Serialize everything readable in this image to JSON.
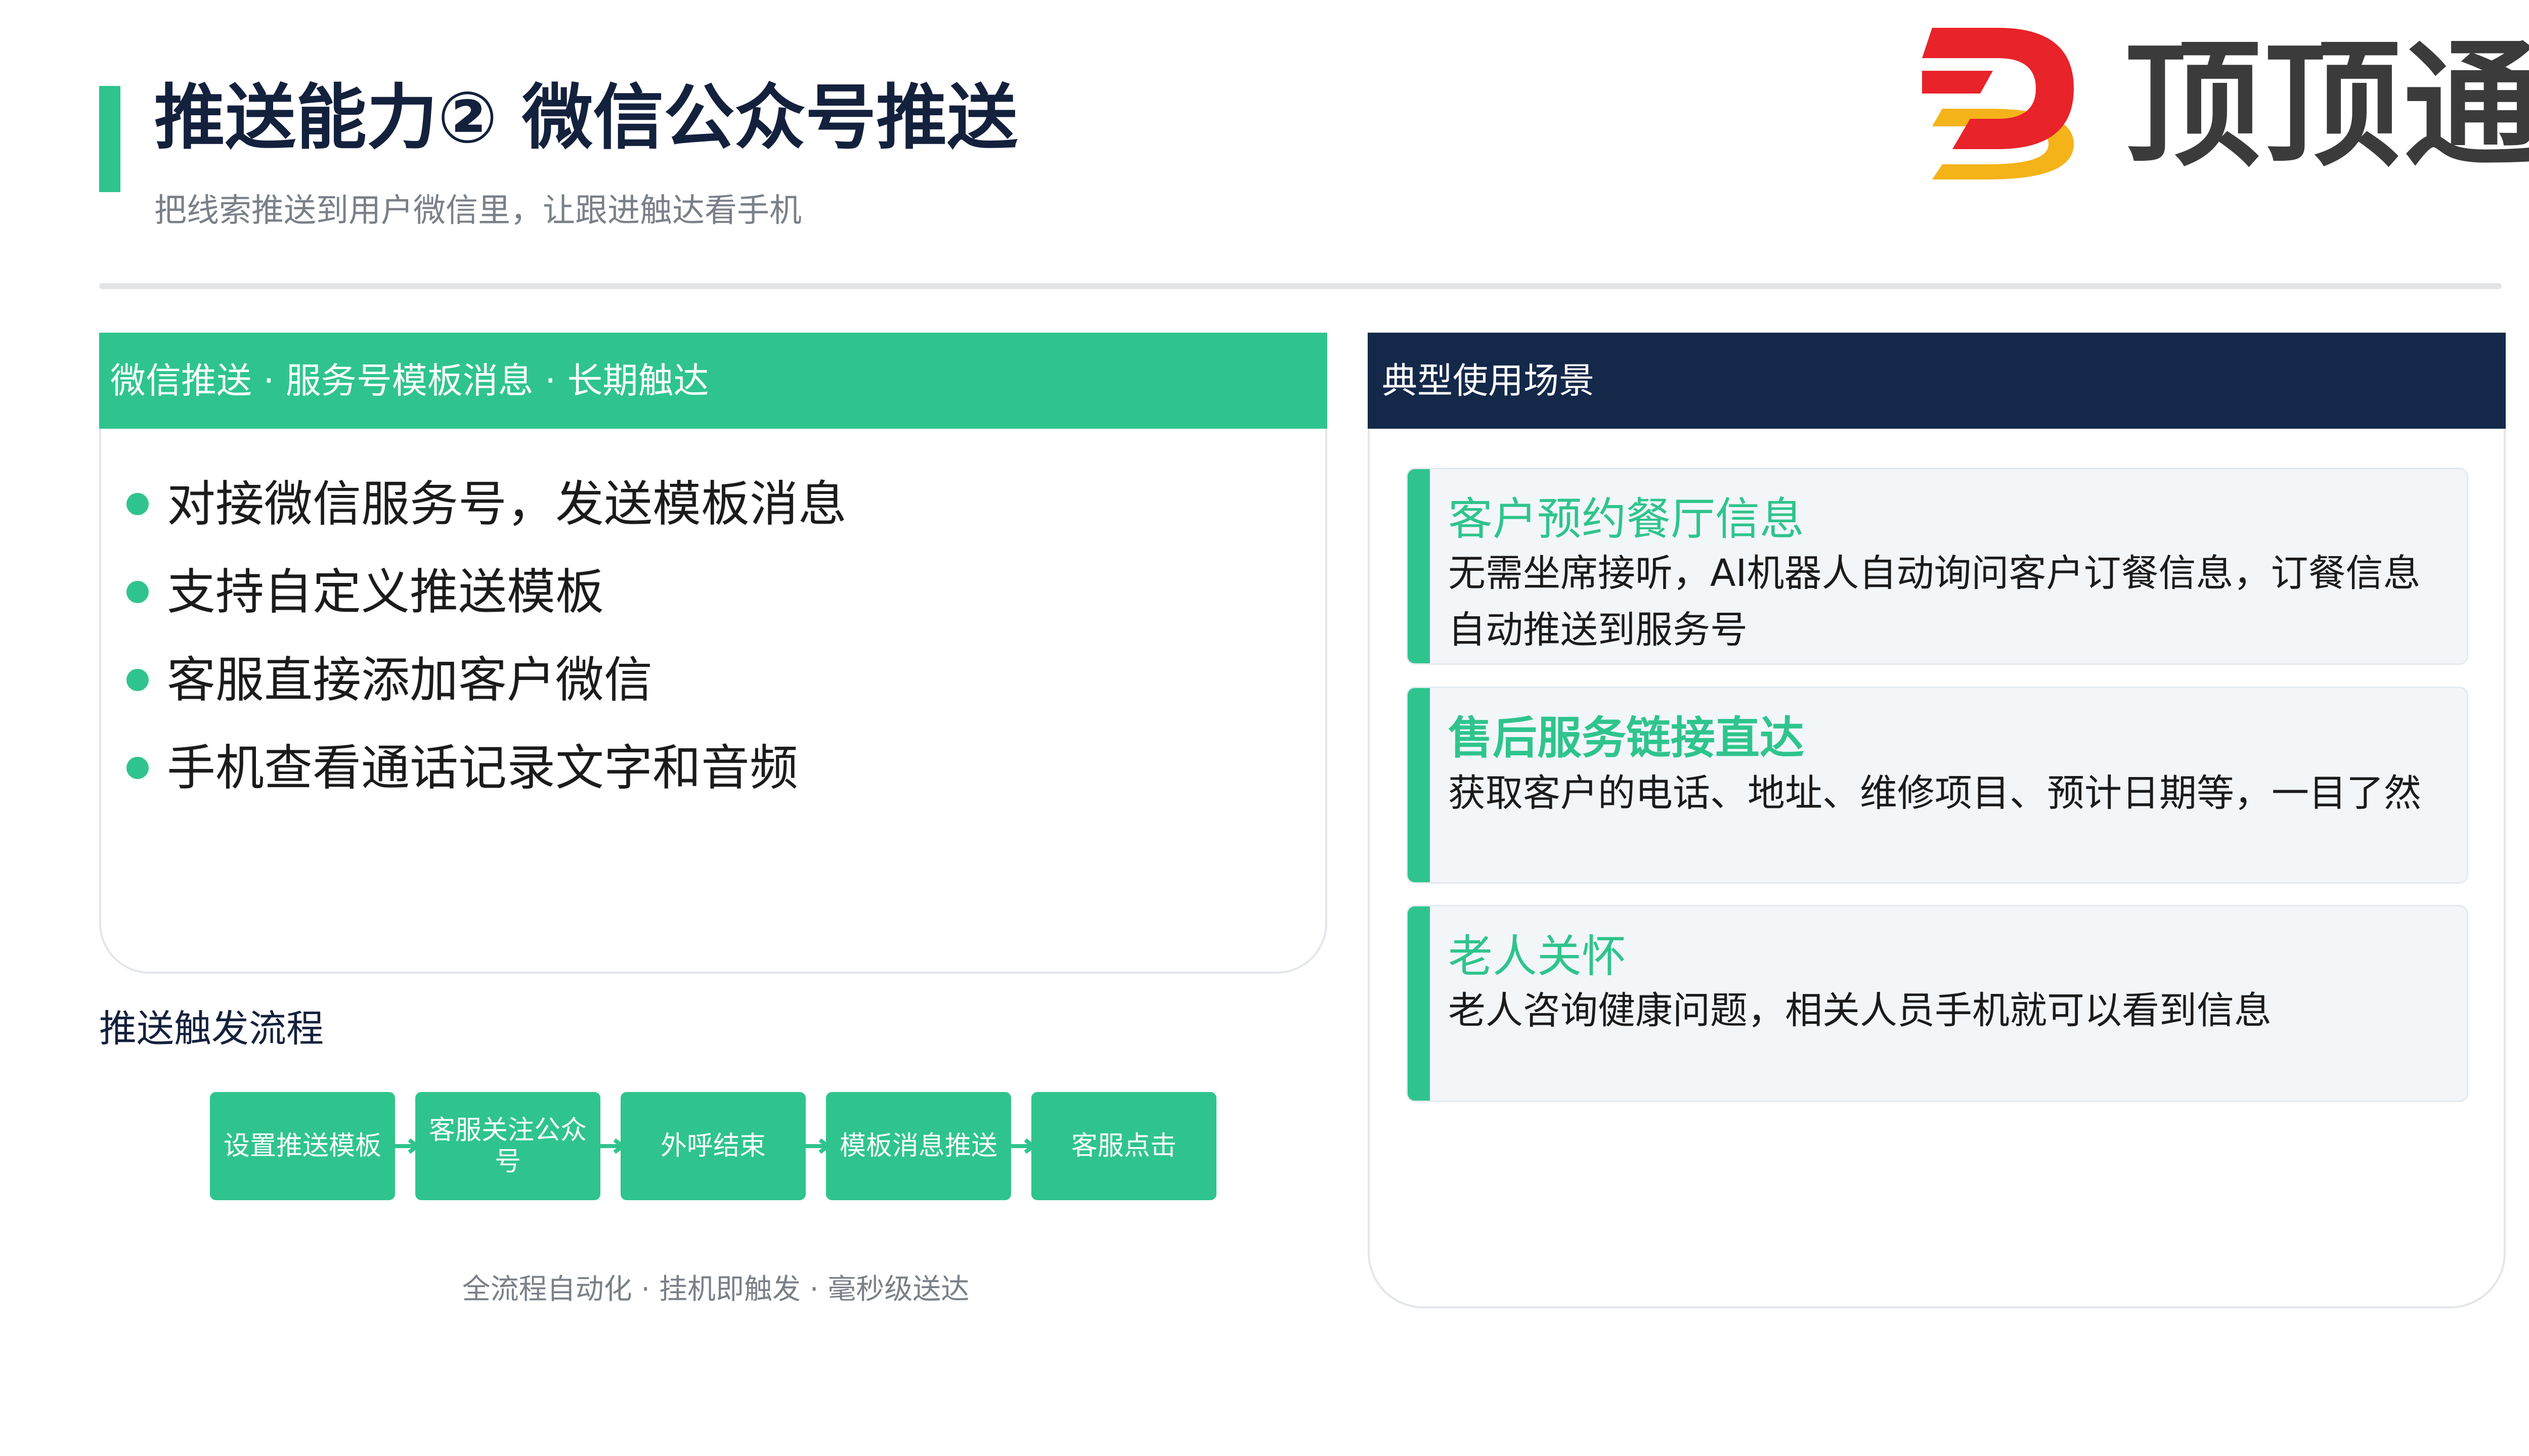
{
  "header": {
    "title": "推送能力② 微信公众号推送",
    "subtitle": "把线索推送到用户微信里，让跟进触达看手机"
  },
  "logo": {
    "text": "顶顶通",
    "colors": {
      "red": "#e8232a",
      "yellow": "#f5b31a",
      "text": "#3b3b3b"
    }
  },
  "left_panel": {
    "heading": "微信推送 · 服务号模板消息 · 长期触达",
    "bullets": [
      "对接微信服务号，发送模板消息",
      "支持自定义推送模板",
      "客服直接添加客户微信",
      "手机查看通话记录文字和音频"
    ]
  },
  "flow": {
    "title": "推送触发流程",
    "steps": [
      "设置推送模板",
      "客服关注公众号",
      "外呼结束",
      "模板消息推送",
      "客服点击"
    ],
    "caption": "全流程自动化 · 挂机即触发 · 毫秒级送达"
  },
  "right_panel": {
    "heading": "典型使用场景",
    "cards": [
      {
        "title": "客户预约餐厅信息",
        "text": "无需坐席接听，AI机器人自动询问客户订餐信息，订餐信息自动推送到服务号"
      },
      {
        "title": "售后服务链接直达",
        "text": "获取客户的电话、地址、维修项目、预计日期等，一目了然"
      },
      {
        "title": "老人关怀",
        "text": "老人咨询健康问题，相关人员手机就可以看到信息"
      }
    ]
  },
  "colors": {
    "accent": "#2fc48d",
    "navy": "#14284a"
  }
}
